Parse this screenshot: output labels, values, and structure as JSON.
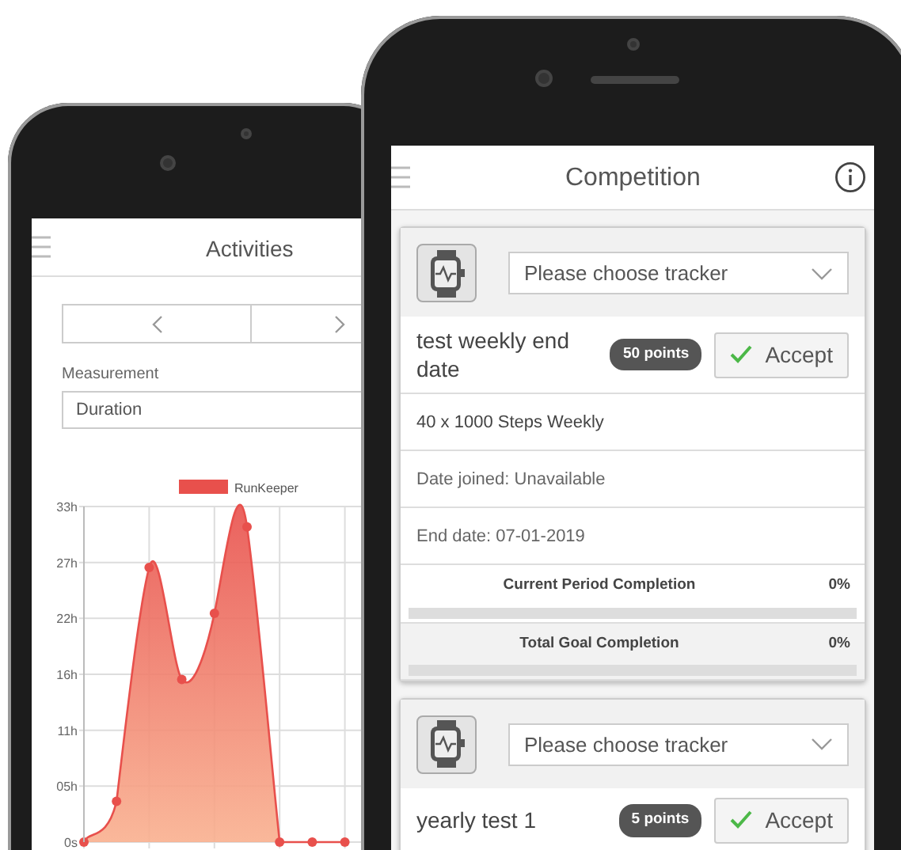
{
  "activities_screen": {
    "title": "Activities",
    "measurement": {
      "label": "Measurement",
      "value": "Duration"
    },
    "chart_data": {
      "type": "area",
      "series": [
        {
          "name": "RunKeeper",
          "color": "#e8504c",
          "values": [
            0,
            4,
            27,
            16,
            22.5,
            31,
            0,
            0,
            0
          ]
        }
      ],
      "ylim": [
        0,
        33
      ],
      "grid": true,
      "yticks": [
        {
          "value": 0,
          "label": "0s"
        },
        {
          "value": 5.5,
          "label": "05h"
        },
        {
          "value": 11,
          "label": "11h"
        },
        {
          "value": 16.5,
          "label": "16h"
        },
        {
          "value": 22,
          "label": "22h"
        },
        {
          "value": 27.5,
          "label": "27h"
        },
        {
          "value": 33,
          "label": "33h"
        }
      ]
    }
  },
  "competition_screen": {
    "title": "Competition",
    "competitions": [
      {
        "tracker_placeholder": "Please choose tracker",
        "name": "test weekly end date",
        "points": "50 points",
        "accept": "Accept",
        "details": [
          "40 x 1000 Steps Weekly",
          "Date joined: Unavailable",
          "End date: 07-01-2019"
        ],
        "progress": [
          {
            "label": "Current Period Completion",
            "reading": "0%",
            "level": 0
          },
          {
            "label": "Total Goal Completion",
            "reading": "0%",
            "level": 0
          }
        ]
      },
      {
        "tracker_placeholder": "Please choose tracker",
        "name": "yearly test 1",
        "points": "5 points",
        "accept": "Accept"
      }
    ]
  }
}
